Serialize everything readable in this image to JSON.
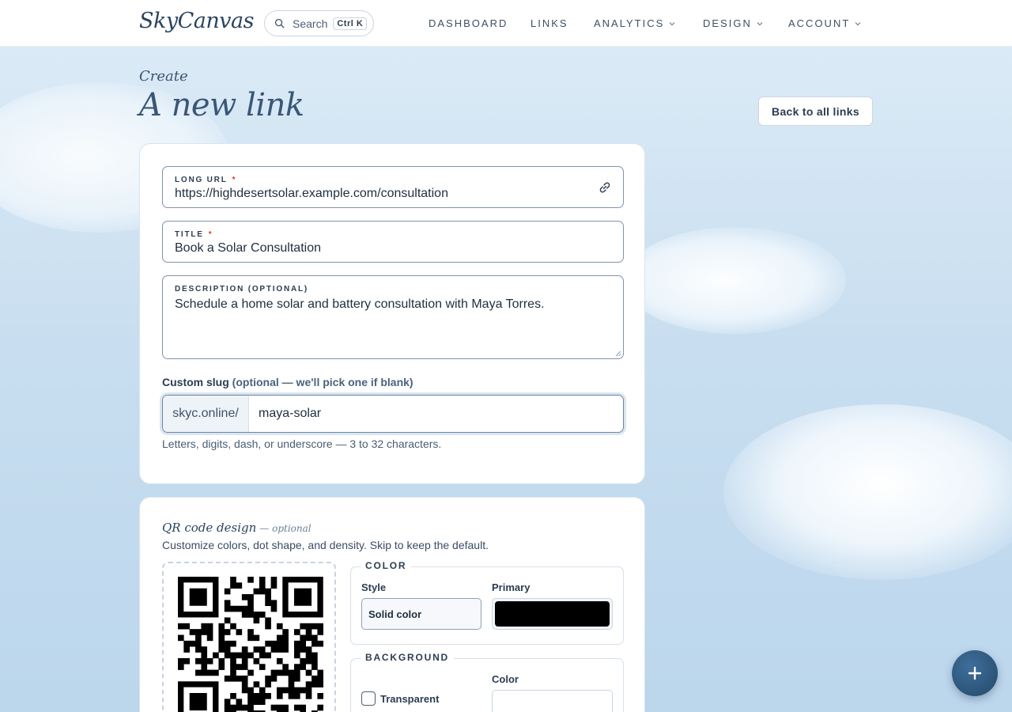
{
  "header": {
    "logo": "SkyCanvas",
    "search_label": "Search",
    "search_shortcut": "Ctrl K",
    "nav": [
      {
        "label": "DASHBOARD",
        "has_menu": false
      },
      {
        "label": "LINKS",
        "has_menu": false
      },
      {
        "label": "ANALYTICS",
        "has_menu": true
      },
      {
        "label": "DESIGN",
        "has_menu": true
      },
      {
        "label": "ACCOUNT",
        "has_menu": true
      }
    ]
  },
  "page": {
    "eyebrow": "Create",
    "title": "A new link",
    "back_button": "Back to all links"
  },
  "form": {
    "long_url": {
      "label": "LONG URL",
      "required_mark": "*",
      "value": "https://highdesertsolar.example.com/consultation"
    },
    "title": {
      "label": "TITLE",
      "required_mark": "*",
      "value": "Book a Solar Consultation"
    },
    "description": {
      "label": "DESCRIPTION (OPTIONAL)",
      "value": "Schedule a home solar and battery consultation with Maya Torres."
    },
    "slug": {
      "label": "Custom slug",
      "label_hint": "(optional — we'll pick one if blank)",
      "prefix": "skyc.online/",
      "value": "maya-solar",
      "help": "Letters, digits, dash, or underscore — 3 to 32 characters."
    }
  },
  "qr": {
    "title": "QR code design",
    "title_optional": "— optional",
    "subtitle": "Customize colors, dot shape, and density. Skip to keep the default.",
    "color_section": {
      "legend": "COLOR",
      "style_label": "Style",
      "style_value": "Solid color",
      "primary_label": "Primary",
      "primary_color": "#000000"
    },
    "background_section": {
      "legend": "BACKGROUND",
      "transparent_label": "Transparent",
      "transparent_checked": false,
      "color_label": "Color",
      "color_value": "#ffffff"
    }
  },
  "fab": {
    "icon": "plus-icon"
  }
}
